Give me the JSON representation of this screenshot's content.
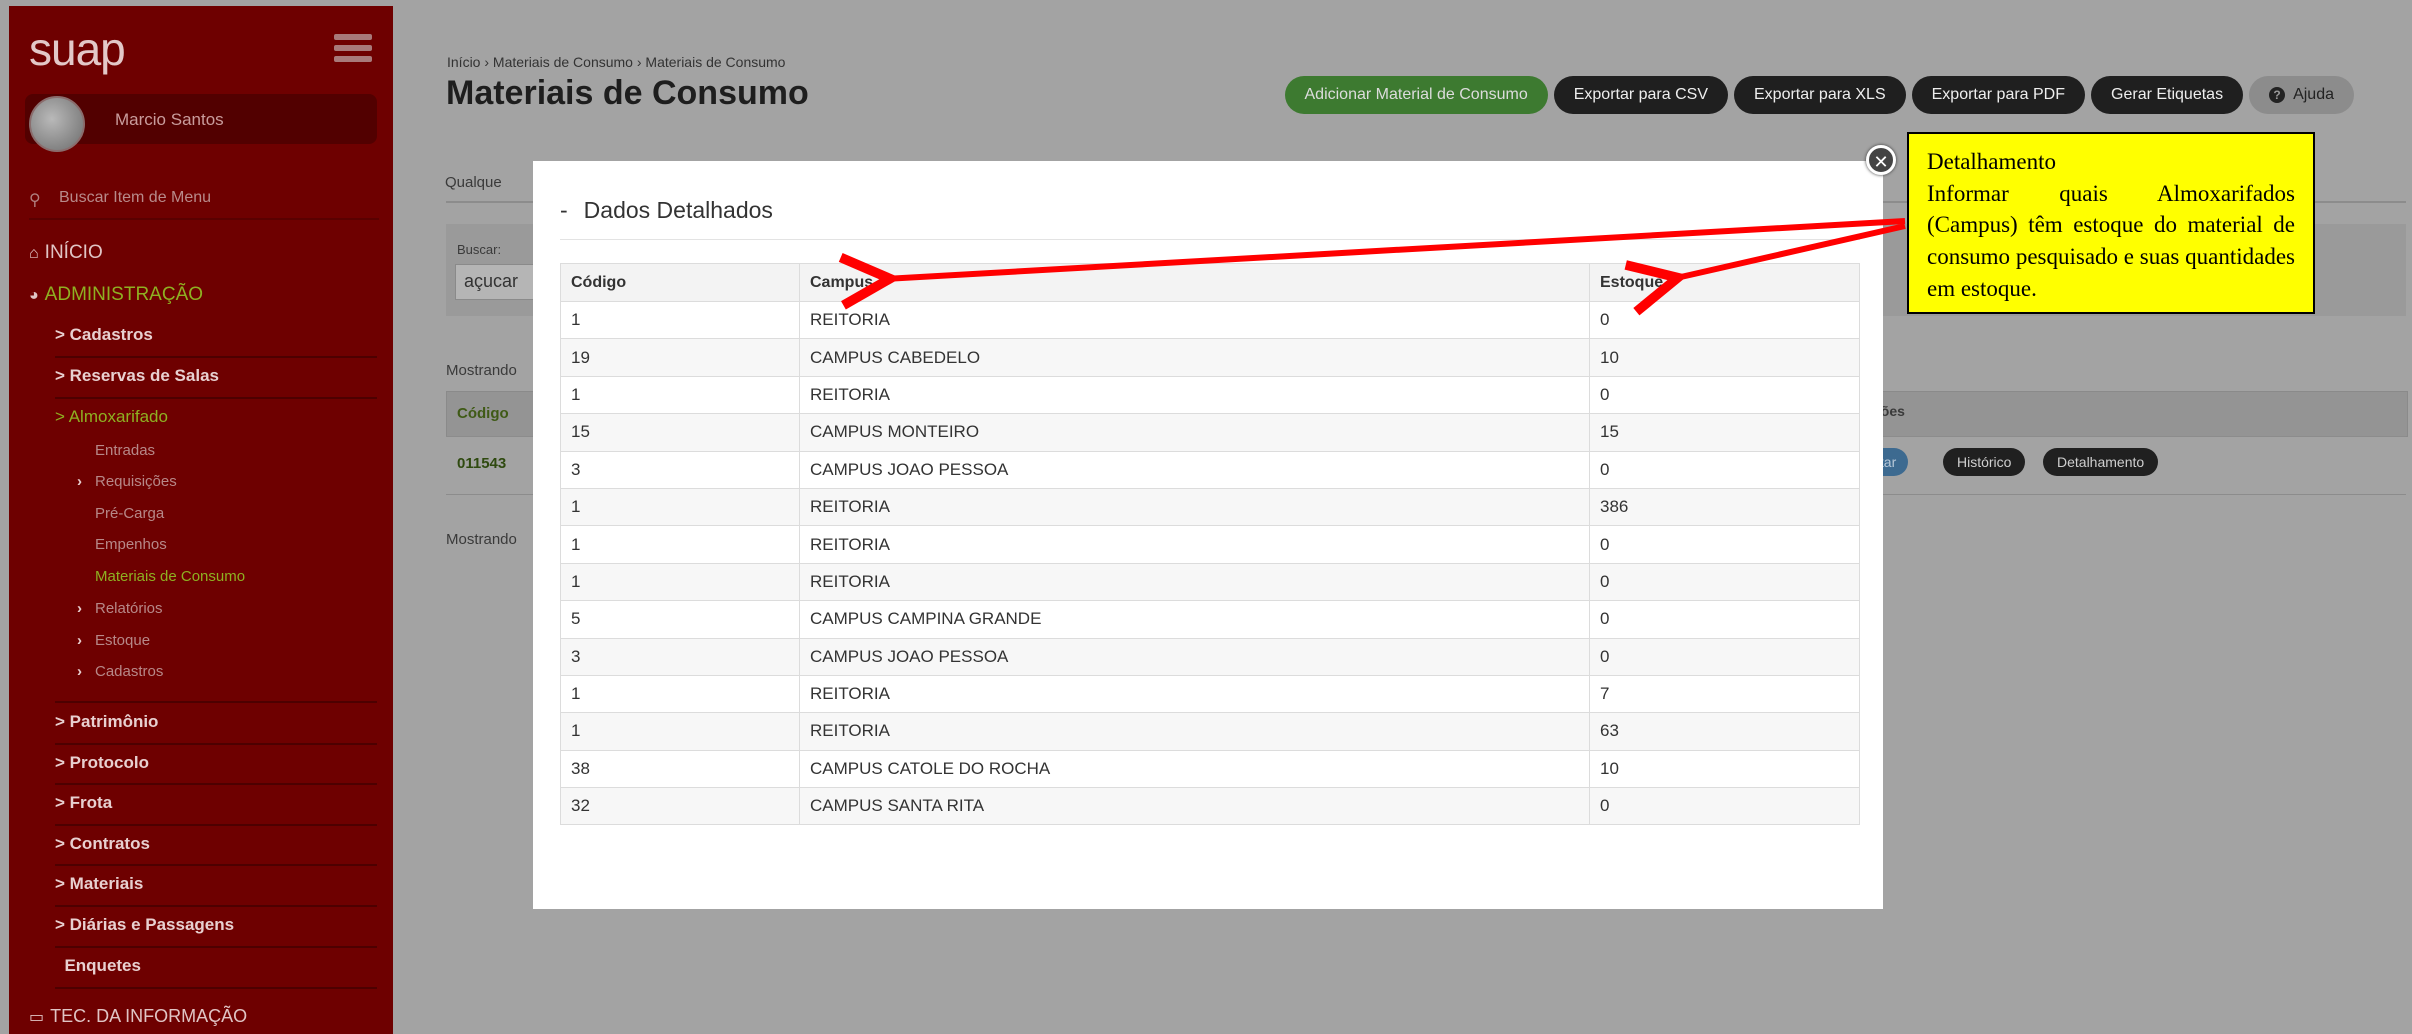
{
  "sidebar": {
    "logo": "suap",
    "user": "Marcio Santos",
    "search_placeholder": "Buscar Item de Menu",
    "inicio": "INÍCIO",
    "administracao": "ADMINISTRAÇÃO",
    "sections": {
      "cadastros": "Cadastros",
      "reservas": "Reservas de Salas",
      "almoxarifado": "Almoxarifado",
      "patrimonio": "Patrimônio",
      "protocolo": "Protocolo",
      "frota": "Frota",
      "contratos": "Contratos",
      "materiais": "Materiais",
      "diarias": "Diárias e Passagens",
      "enquetes": "Enquetes"
    },
    "subs": {
      "entradas": "Entradas",
      "requisicoes": "Requisições",
      "precarga": "Pré-Carga",
      "empenhos": "Empenhos",
      "materiais_consumo": "Materiais de Consumo",
      "relatorios": "Relatórios",
      "estoque": "Estoque",
      "cadastros": "Cadastros"
    },
    "tec": "TEC. DA INFORMAÇÃO"
  },
  "header": {
    "breadcrumb": "Início › Materiais de Consumo › Materiais de Consumo",
    "title": "Materiais de Consumo",
    "buttons": {
      "add": "Adicionar Material de Consumo",
      "csv": "Exportar para CSV",
      "xls": "Exportar para XLS",
      "pdf": "Exportar para PDF",
      "labels": "Gerar Etiquetas",
      "help": "Ajuda"
    }
  },
  "background": {
    "tab_label": "Qualque",
    "search_label": "Buscar:",
    "search_value": "açucar",
    "showing_1": "Mostrando",
    "showing_2": "Mostrando",
    "col_codigo": "Código",
    "col_acoes": "ções",
    "row_code": "011543",
    "pill_edit": "ditar",
    "pill_hist": "Histórico",
    "pill_detail": "Detalhamento"
  },
  "modal": {
    "dash": "-",
    "title": "Dados Detalhados",
    "columns": [
      "Código",
      "Campus",
      "Estoque"
    ],
    "rows": [
      [
        "1",
        "REITORIA",
        "0"
      ],
      [
        "19",
        "CAMPUS CABEDELO",
        "10"
      ],
      [
        "1",
        "REITORIA",
        "0"
      ],
      [
        "15",
        "CAMPUS MONTEIRO",
        "15"
      ],
      [
        "3",
        "CAMPUS JOAO PESSOA",
        "0"
      ],
      [
        "1",
        "REITORIA",
        "386"
      ],
      [
        "1",
        "REITORIA",
        "0"
      ],
      [
        "1",
        "REITORIA",
        "0"
      ],
      [
        "5",
        "CAMPUS CAMPINA GRANDE",
        "0"
      ],
      [
        "3",
        "CAMPUS JOAO PESSOA",
        "0"
      ],
      [
        "1",
        "REITORIA",
        "7"
      ],
      [
        "1",
        "REITORIA",
        "63"
      ],
      [
        "38",
        "CAMPUS CATOLE DO ROCHA",
        "10"
      ],
      [
        "32",
        "CAMPUS SANTA RITA",
        "0"
      ]
    ],
    "close_glyph": "✕"
  },
  "annotation": {
    "title": "Detalhamento",
    "body": "Informar quais Almoxarifados (Campus) têm estoque do material de consumo pesquisado e suas quantidades em estoque.",
    "color": "#ffff00",
    "arrow_color": "#ff0000"
  },
  "icons": {
    "menu": "hamburger-icon",
    "search": "search-icon",
    "home": "home-icon",
    "admin": "pie-chart-icon",
    "monitor": "monitor-icon",
    "help": "question-circle-icon",
    "close": "close-icon"
  }
}
